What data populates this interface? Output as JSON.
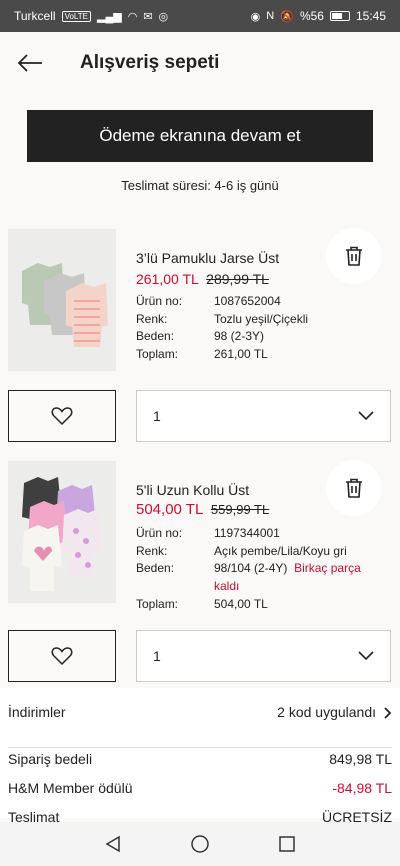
{
  "status": {
    "carrier": "Turkcell",
    "volte": "VoLTE",
    "battery": "%56",
    "time": "15:45"
  },
  "header": {
    "title": "Alışveriş sepeti"
  },
  "checkout": {
    "label": "Ödeme ekranına devam et"
  },
  "delivery_text": "Teslimat süresi: 4-6 iş günü",
  "items": [
    {
      "name": "3’lü Pamuklu Jarse Üst",
      "price": "261,00 TL",
      "old_price": "289,99 TL",
      "product_no_label": "Ürün no:",
      "product_no": "1087652004",
      "color_label": "Renk:",
      "color": "Tozlu yeşil/Çiçekli",
      "size_label": "Beden:",
      "size": "98 (2-3Y)",
      "total_label": "Toplam:",
      "total": "261,00 TL",
      "quantity": "1"
    },
    {
      "name": "5'li Uzun Kollu Üst",
      "price": "504,00 TL",
      "old_price": "559,99 TL",
      "product_no_label": "Ürün no:",
      "product_no": "1197344001",
      "color_label": "Renk:",
      "color": "Açık pembe/Lila/Koyu gri",
      "size_label": "Beden:",
      "size": "98/104 (2-4Y)",
      "stock_note": "Birkaç parça kaldı",
      "total_label": "Toplam:",
      "total": "504,00 TL",
      "quantity": "1"
    }
  ],
  "summary": {
    "discounts_label": "İndirimler",
    "discounts_value": "2 kod uygulandı",
    "order_value_label": "Sipariş bedeli",
    "order_value": "849,98 TL",
    "member_label": "H&M Member ödülü",
    "member_value": "-84,98 TL",
    "delivery_label": "Teslimat",
    "delivery_value": "ÜCRETSİZ"
  },
  "colors": {
    "accent_red": "#c8102e",
    "button_dark": "#222222"
  }
}
